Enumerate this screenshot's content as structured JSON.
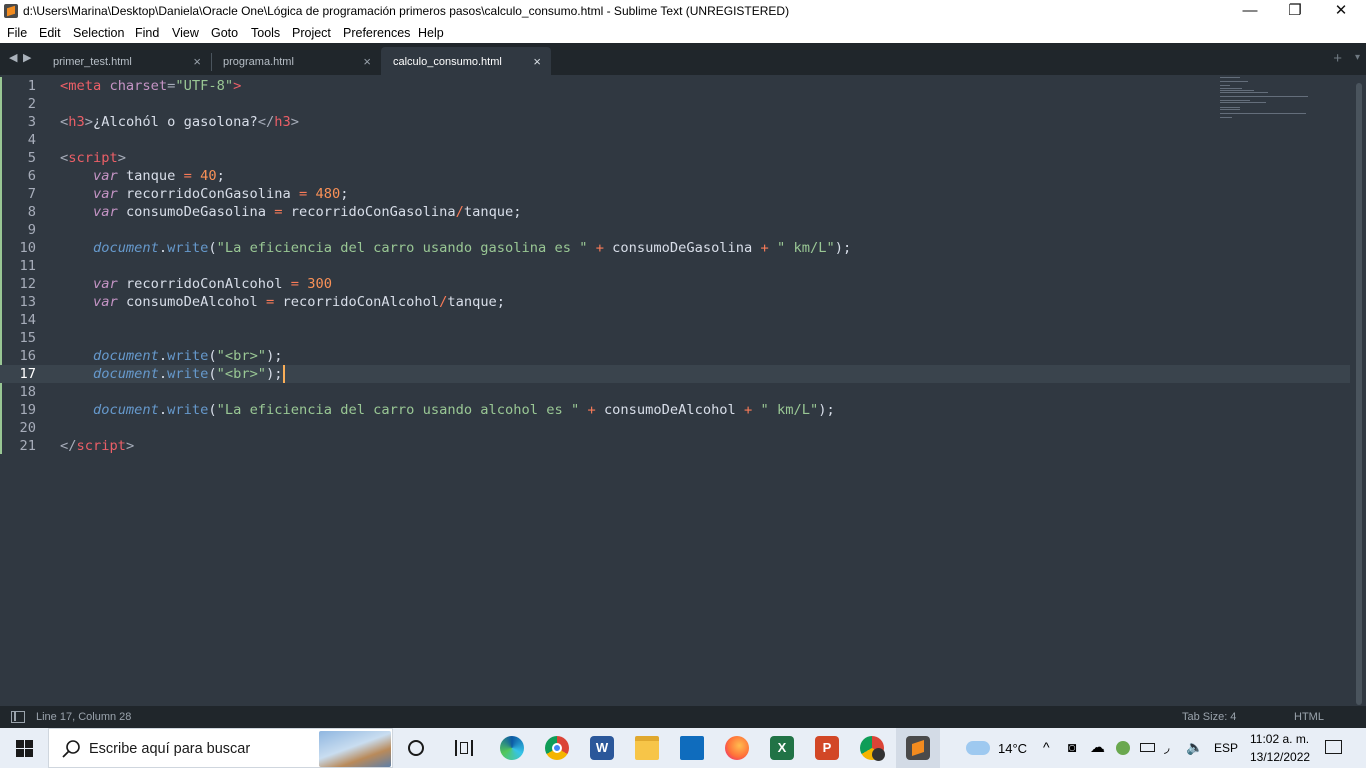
{
  "window": {
    "title": "d:\\Users\\Marina\\Desktop\\Daniela\\Oracle One\\Lógica de programación primeros pasos\\calculo_consumo.html - Sublime Text (UNREGISTERED)",
    "minimize": "—",
    "maximize": "❐",
    "close": "✕"
  },
  "menu": [
    "File",
    "Edit",
    "Selection",
    "Find",
    "View",
    "Goto",
    "Tools",
    "Project",
    "Preferences",
    "Help"
  ],
  "tabs": [
    {
      "label": "primer_test.html",
      "close": "×"
    },
    {
      "label": "programa.html",
      "close": "×"
    },
    {
      "label": "calculo_consumo.html",
      "close": "×",
      "active": true
    }
  ],
  "tab_nav": {
    "left": "◀",
    "right": "▶",
    "new": "+",
    "more": "▾"
  },
  "editor": {
    "active_line": 17,
    "lines": [
      {
        "n": "1",
        "tokens": [
          [
            "t-tag",
            "<meta"
          ],
          [
            "t-var",
            " "
          ],
          [
            "t-attr",
            "charset"
          ],
          [
            "t-punc",
            "="
          ],
          [
            "t-str",
            "\"UTF-8\""
          ],
          [
            "t-tag",
            ">"
          ]
        ]
      },
      {
        "n": "2",
        "tokens": []
      },
      {
        "n": "3",
        "tokens": [
          [
            "t-punc",
            "<"
          ],
          [
            "t-tag",
            "h3"
          ],
          [
            "t-punc",
            ">"
          ],
          [
            "t-var",
            "¿Alcohól o gasolona?"
          ],
          [
            "t-punc",
            "</"
          ],
          [
            "t-tag",
            "h3"
          ],
          [
            "t-punc",
            ">"
          ]
        ]
      },
      {
        "n": "4",
        "tokens": []
      },
      {
        "n": "5",
        "tokens": [
          [
            "t-punc",
            "<"
          ],
          [
            "t-tag",
            "script"
          ],
          [
            "t-punc",
            ">"
          ]
        ]
      },
      {
        "n": "6",
        "tokens": [
          [
            "t-var",
            "    "
          ],
          [
            "t-kw",
            "var"
          ],
          [
            "t-var",
            " tanque "
          ],
          [
            "t-op",
            "="
          ],
          [
            "t-var",
            " "
          ],
          [
            "t-num",
            "40"
          ],
          [
            "t-var",
            ";"
          ]
        ]
      },
      {
        "n": "7",
        "tokens": [
          [
            "t-var",
            "    "
          ],
          [
            "t-kw",
            "var"
          ],
          [
            "t-var",
            " recorridoConGasolina "
          ],
          [
            "t-op",
            "="
          ],
          [
            "t-var",
            " "
          ],
          [
            "t-num",
            "480"
          ],
          [
            "t-var",
            ";"
          ]
        ]
      },
      {
        "n": "8",
        "tokens": [
          [
            "t-var",
            "    "
          ],
          [
            "t-kw",
            "var"
          ],
          [
            "t-var",
            " consumoDeGasolina "
          ],
          [
            "t-op",
            "="
          ],
          [
            "t-var",
            " recorridoConGasolina"
          ],
          [
            "t-op",
            "/"
          ],
          [
            "t-var",
            "tanque;"
          ]
        ]
      },
      {
        "n": "9",
        "tokens": []
      },
      {
        "n": "10",
        "tokens": [
          [
            "t-var",
            "    "
          ],
          [
            "t-obj",
            "document"
          ],
          [
            "t-var",
            "."
          ],
          [
            "t-fn",
            "write"
          ],
          [
            "t-var",
            "("
          ],
          [
            "t-str",
            "\"La eficiencia del carro usando gasolina es \""
          ],
          [
            "t-var",
            " "
          ],
          [
            "t-op",
            "+"
          ],
          [
            "t-var",
            " consumoDeGasolina "
          ],
          [
            "t-op",
            "+"
          ],
          [
            "t-var",
            " "
          ],
          [
            "t-str",
            "\" km/L\""
          ],
          [
            "t-var",
            ");"
          ]
        ]
      },
      {
        "n": "11",
        "tokens": []
      },
      {
        "n": "12",
        "tokens": [
          [
            "t-var",
            "    "
          ],
          [
            "t-kw",
            "var"
          ],
          [
            "t-var",
            " recorridoConAlcohol "
          ],
          [
            "t-op",
            "="
          ],
          [
            "t-var",
            " "
          ],
          [
            "t-num",
            "300"
          ]
        ]
      },
      {
        "n": "13",
        "tokens": [
          [
            "t-var",
            "    "
          ],
          [
            "t-kw",
            "var"
          ],
          [
            "t-var",
            " consumoDeAlcohol "
          ],
          [
            "t-op",
            "="
          ],
          [
            "t-var",
            " recorridoConAlcohol"
          ],
          [
            "t-op",
            "/"
          ],
          [
            "t-var",
            "tanque;"
          ]
        ]
      },
      {
        "n": "14",
        "tokens": []
      },
      {
        "n": "15",
        "tokens": []
      },
      {
        "n": "16",
        "tokens": [
          [
            "t-var",
            "    "
          ],
          [
            "t-obj",
            "document"
          ],
          [
            "t-var",
            "."
          ],
          [
            "t-fn",
            "write"
          ],
          [
            "t-var",
            "("
          ],
          [
            "t-str",
            "\"<br>\""
          ],
          [
            "t-var",
            ");"
          ]
        ]
      },
      {
        "n": "17",
        "tokens": [
          [
            "t-var",
            "    "
          ],
          [
            "t-obj",
            "document"
          ],
          [
            "t-var",
            "."
          ],
          [
            "t-fn",
            "write"
          ],
          [
            "t-var",
            "("
          ],
          [
            "t-str",
            "\"<br>\""
          ],
          [
            "t-var",
            ");"
          ]
        ],
        "caret": true
      },
      {
        "n": "18",
        "tokens": []
      },
      {
        "n": "19",
        "tokens": [
          [
            "t-var",
            "    "
          ],
          [
            "t-obj",
            "document"
          ],
          [
            "t-var",
            "."
          ],
          [
            "t-fn",
            "write"
          ],
          [
            "t-var",
            "("
          ],
          [
            "t-str",
            "\"La eficiencia del carro usando alcohol es \""
          ],
          [
            "t-var",
            " "
          ],
          [
            "t-op",
            "+"
          ],
          [
            "t-var",
            " consumoDeAlcohol "
          ],
          [
            "t-op",
            "+"
          ],
          [
            "t-var",
            " "
          ],
          [
            "t-str",
            "\" km/L\""
          ],
          [
            "t-var",
            ");"
          ]
        ]
      },
      {
        "n": "20",
        "tokens": []
      },
      {
        "n": "21",
        "tokens": [
          [
            "t-punc",
            "</"
          ],
          [
            "t-tag",
            "script"
          ],
          [
            "t-punc",
            ">"
          ]
        ]
      }
    ]
  },
  "status": {
    "position": "Line 17, Column 28",
    "tab_size": "Tab Size: 4",
    "syntax": "HTML"
  },
  "taskbar": {
    "search_placeholder": "Escribe aquí para buscar",
    "weather": "14°C",
    "language": "ESP",
    "time": "11:02 a. m.",
    "date": "13/12/2022",
    "apps": [
      "cortana-icon",
      "task-view-icon",
      "edge-icon",
      "chrome-icon",
      "word-icon",
      "file-explorer-icon",
      "mail-icon",
      "firefox-icon",
      "excel-icon",
      "powerpoint-icon",
      "chrome-profile-icon",
      "sublime-text-icon"
    ]
  }
}
